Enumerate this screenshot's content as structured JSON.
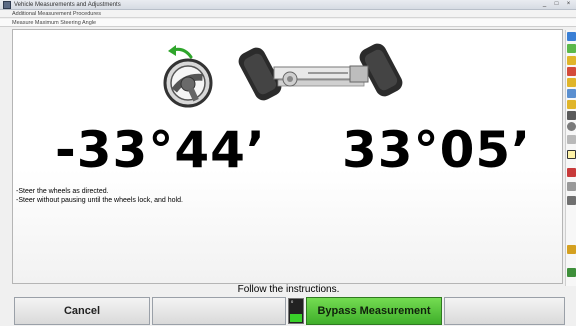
{
  "window": {
    "title": "Vehicle Measurements and Adjustments",
    "controls": [
      "_",
      "□",
      "×"
    ]
  },
  "breadcrumbs": [
    "Additional Measurement Procedures",
    "Measure Maximum Steering Angle"
  ],
  "main": {
    "left_angle": "-33°44’",
    "right_angle": "33°05’",
    "instructions": [
      "-Steer the wheels as directed.",
      "-Steer without pausing until the wheels lock, and hold."
    ],
    "icons": [
      "turn-left-arrow-icon",
      "steering-wheel-icon",
      "front-axle-icon"
    ]
  },
  "status": "Follow the instructions.",
  "buttons": {
    "cancel": "Cancel",
    "blank1": "",
    "bypass": "Bypass Measurement",
    "blank2": ""
  },
  "progress": {
    "level": 0.35,
    "scale_top": "0"
  },
  "colors": {
    "arrow": "#2fa52b",
    "bypass_button": "#4cc236",
    "progress_fill": "#39d12a"
  },
  "sidebar_icons": [
    "help-icon",
    "home-icon",
    "camber-icon",
    "caster-icon",
    "toe-icon",
    "setback-icon",
    "thrust-icon",
    "sai-icon",
    "wheel-icon",
    "adjust-icon",
    "curve-icon",
    "car-icon",
    "print-icon",
    "tools-icon",
    "vehicle-side-icon",
    "display-icon"
  ]
}
